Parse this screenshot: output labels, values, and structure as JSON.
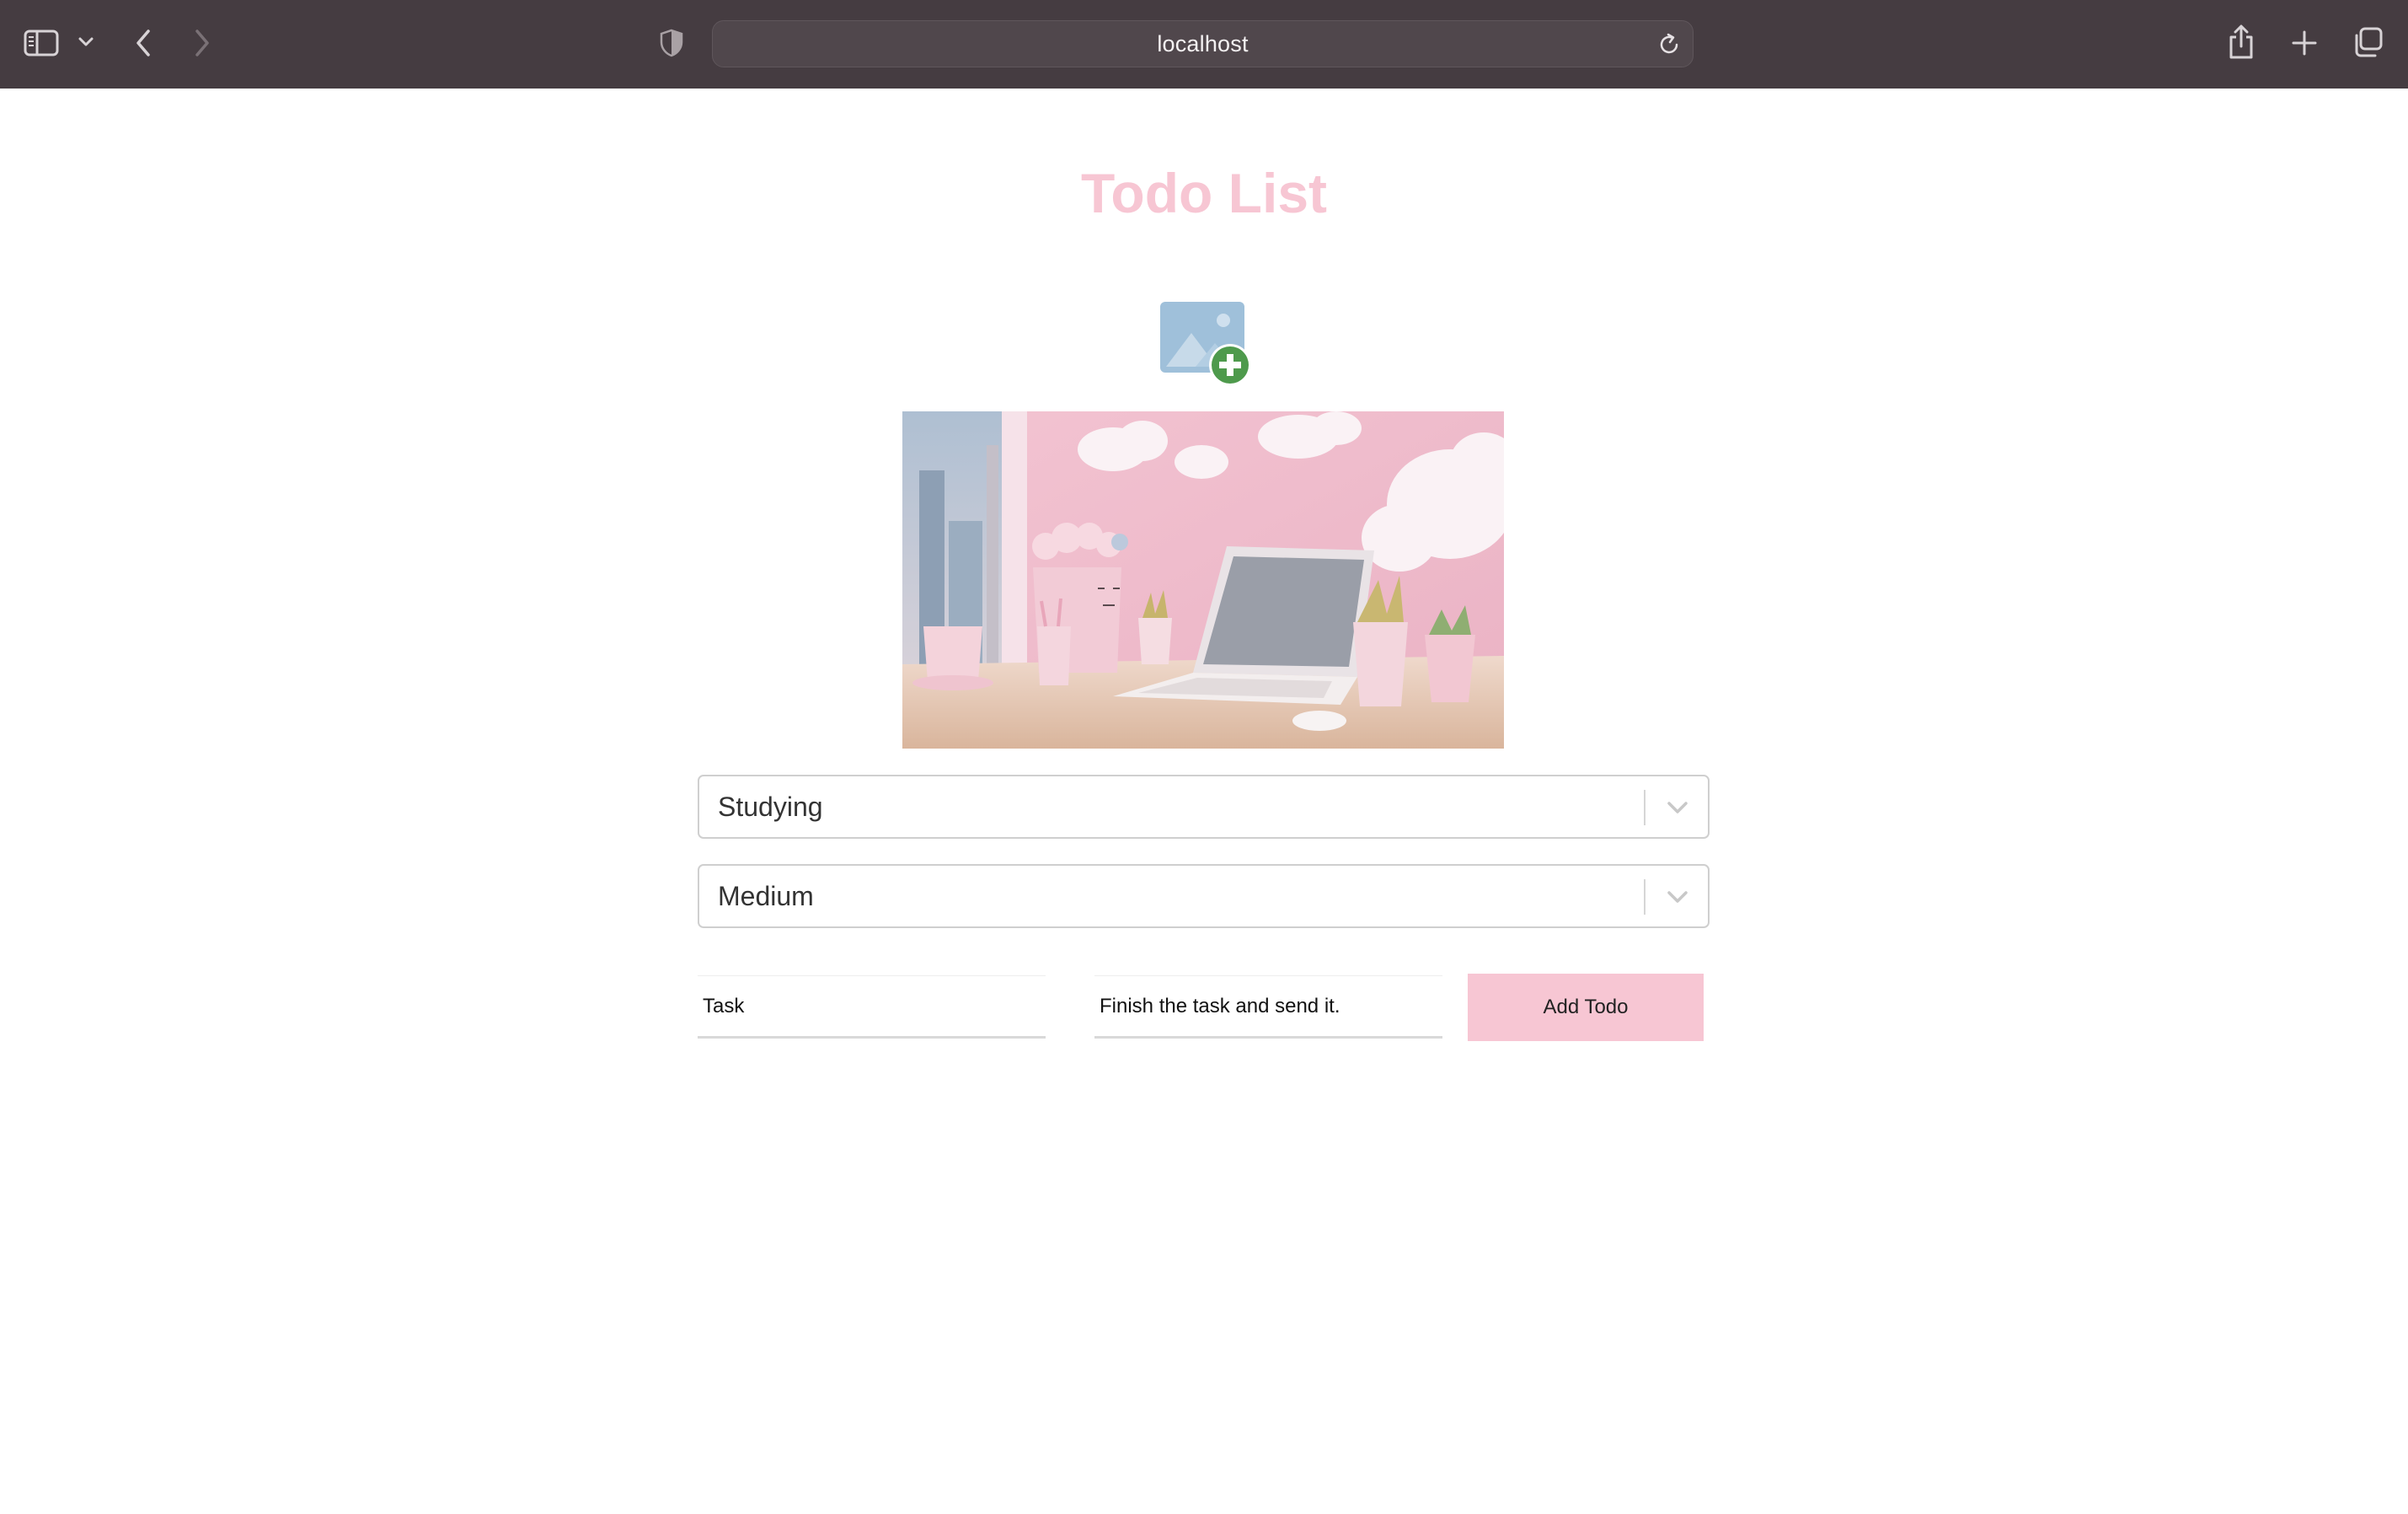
{
  "browser": {
    "address": "localhost",
    "icons": {
      "sidebar": "sidebar-toggle-icon",
      "sidebar_menu": "chevron-down-icon",
      "back": "chevron-left-icon",
      "forward": "chevron-right-icon",
      "privacy": "shield-icon",
      "reload": "reload-icon",
      "share": "share-icon",
      "new_tab": "plus-icon",
      "tabs": "tabs-overview-icon"
    }
  },
  "page": {
    "title": "Todo List",
    "title_color": "#f7c6d3",
    "upload_icon": "image-add-icon",
    "image_description_icon": "pink-desk-illustration"
  },
  "form": {
    "category_value": "Studying",
    "priority_value": "Medium",
    "task_value": "Task",
    "description_value": "Finish the task and send it.",
    "add_button_label": "Add Todo",
    "button_color": "#f7c6d3"
  }
}
